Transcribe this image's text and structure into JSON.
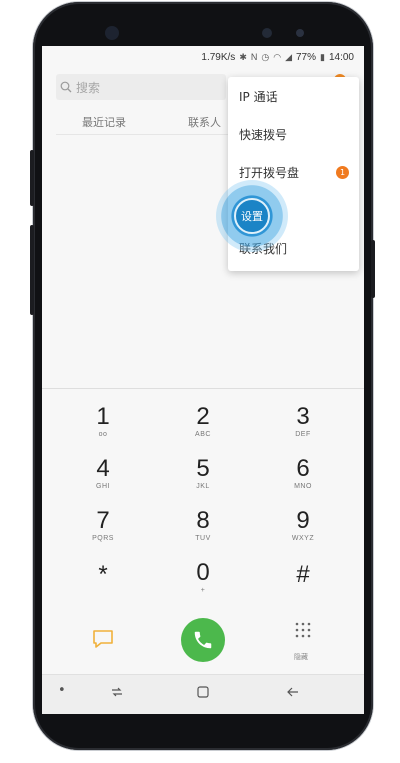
{
  "status_bar": {
    "speed": "1.79K/s",
    "battery": "77%",
    "time": "14:00",
    "icons": [
      "bluetooth-icon",
      "nfc-icon",
      "alarm-icon",
      "wifi-icon",
      "signal-icon",
      "battery-icon"
    ]
  },
  "search": {
    "placeholder": "搜索"
  },
  "tabs": [
    {
      "label": "最近记录"
    },
    {
      "label": "联系人"
    }
  ],
  "menu": {
    "items": [
      {
        "label": "IP 通话"
      },
      {
        "label": "快速拨号"
      },
      {
        "label": "打开拨号盘",
        "badge": "1"
      },
      {
        "label": "设置"
      },
      {
        "label": "联系我们"
      }
    ]
  },
  "keypad": {
    "keys": [
      {
        "digit": "1",
        "letters": "oo"
      },
      {
        "digit": "2",
        "letters": "ABC"
      },
      {
        "digit": "3",
        "letters": "DEF"
      },
      {
        "digit": "4",
        "letters": "GHI"
      },
      {
        "digit": "5",
        "letters": "JKL"
      },
      {
        "digit": "6",
        "letters": "MNO"
      },
      {
        "digit": "7",
        "letters": "PQRS"
      },
      {
        "digit": "8",
        "letters": "TUV"
      },
      {
        "digit": "9",
        "letters": "WXYZ"
      },
      {
        "digit": "*",
        "letters": ""
      },
      {
        "digit": "0",
        "letters": "+"
      },
      {
        "digit": "#",
        "letters": ""
      }
    ]
  },
  "action_bar": {
    "hide_label": "隐藏"
  },
  "colors": {
    "accent_call": "#4cb84c",
    "accent_touch": "#1b84c6",
    "badge": "#f07a1f",
    "message_icon": "#f0b13a"
  }
}
